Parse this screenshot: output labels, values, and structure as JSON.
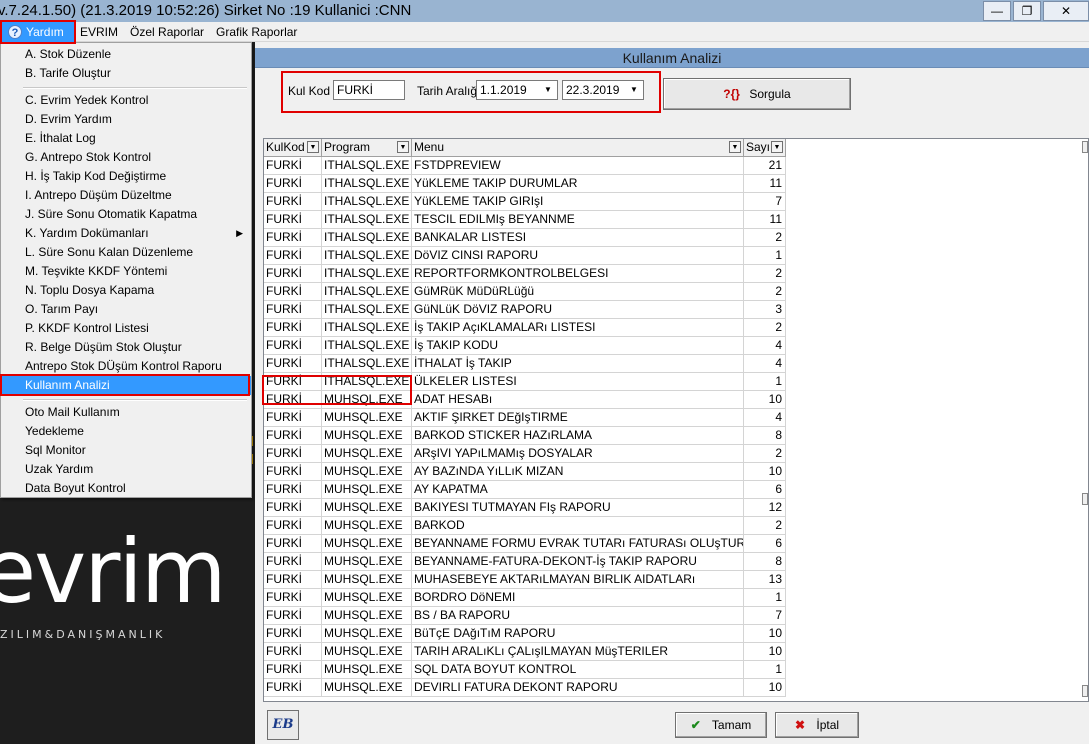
{
  "window": {
    "title": "v.7.24.1.50) (21.3.2019 10:52:26) Sirket No :19 Kullanici :CNN",
    "min_label": "—",
    "max_label": "❐",
    "close_label": "✕"
  },
  "menubar": {
    "items": [
      {
        "label": "Yardım"
      },
      {
        "label": "EVRIM"
      },
      {
        "label": "Özel Raporlar"
      },
      {
        "label": "Grafik Raporlar"
      }
    ]
  },
  "dropdown": {
    "items": [
      {
        "label": "A.  Stok Düzenle"
      },
      {
        "label": "B.  Tarife Oluştur"
      },
      {
        "label": "C.  Evrim Yedek Kontrol"
      },
      {
        "label": "D.  Evrim Yardım"
      },
      {
        "label": "E.  İthalat Log"
      },
      {
        "label": "G.  Antrepo Stok Kontrol"
      },
      {
        "label": "H.  İş Takip Kod Değiştirme"
      },
      {
        "label": "I.   Antrepo Düşüm Düzeltme"
      },
      {
        "label": "J.  Süre Sonu Otomatik Kapatma"
      },
      {
        "label": "K.  Yardım Dokümanları"
      },
      {
        "label": "L. Süre Sonu Kalan Düzenleme"
      },
      {
        "label": "M. Teşvikte KKDF Yöntemi"
      },
      {
        "label": "N. Toplu Dosya Kapama"
      },
      {
        "label": "O. Tarım Payı"
      },
      {
        "label": "P. KKDF Kontrol Listesi"
      },
      {
        "label": "R. Belge Düşüm Stok Oluştur"
      },
      {
        "label": "Antrepo Stok DÜşüm Kontrol Raporu"
      },
      {
        "label": "Kullanım Analizi"
      },
      {
        "label": "Oto Mail Kullanım"
      },
      {
        "label": "Yedekleme"
      },
      {
        "label": "Sql Monitor"
      },
      {
        "label": "Uzak Yardım"
      },
      {
        "label": "Data Boyut Kontrol"
      }
    ],
    "submenu_arrow": "▶"
  },
  "logo": {
    "word": "evrim",
    "sub": "ZILIM&DANIŞMANLIK"
  },
  "form": {
    "title": "Kullanım Analizi",
    "kulkod_label": "Kul Kod",
    "kulkod_value": "FURKİ",
    "tarih_label": "Tarih Aralığı",
    "date_from": "1.1.2019",
    "date_to": "22.3.2019",
    "sorgula_label": "Sorgula",
    "sorgula_icon": "?{}"
  },
  "grid": {
    "columns": [
      "KulKod",
      "Program",
      "Menu",
      "Sayı"
    ],
    "filter_glyph": "▼",
    "rows": [
      [
        "FURKİ",
        "ITHALSQL.EXE",
        "FSTDPREVIEW",
        "21"
      ],
      [
        "FURKİ",
        "ITHALSQL.EXE",
        "YüKLEME TAKIP DURUMLAR",
        "11"
      ],
      [
        "FURKİ",
        "ITHALSQL.EXE",
        "YüKLEME TAKIP GIRIşI",
        "7"
      ],
      [
        "FURKİ",
        "ITHALSQL.EXE",
        "TESCIL EDILMIş BEYANNME",
        "11"
      ],
      [
        "FURKİ",
        "ITHALSQL.EXE",
        "BANKALAR LISTESI",
        "2"
      ],
      [
        "FURKİ",
        "ITHALSQL.EXE",
        "DöVIZ CINSI RAPORU",
        "1"
      ],
      [
        "FURKİ",
        "ITHALSQL.EXE",
        "REPORTFORMKONTROLBELGESI",
        "2"
      ],
      [
        "FURKİ",
        "ITHALSQL.EXE",
        "GüMRüK MüDüRLüğü",
        "2"
      ],
      [
        "FURKİ",
        "ITHALSQL.EXE",
        "GüNLüK DöVIZ RAPORU",
        "3"
      ],
      [
        "FURKİ",
        "ITHALSQL.EXE",
        "İş TAKIP AçıKLAMALARı LISTESI",
        "2"
      ],
      [
        "FURKİ",
        "ITHALSQL.EXE",
        "İş TAKIP KODU",
        "4"
      ],
      [
        "FURKİ",
        "ITHALSQL.EXE",
        "İTHALAT İş TAKIP",
        "4"
      ],
      [
        "FURKİ",
        "ITHALSQL.EXE",
        "ÜLKELER LISTESI",
        "1"
      ],
      [
        "FURKİ",
        "MUHSQL.EXE",
        "ADAT HESABı",
        "10"
      ],
      [
        "FURKİ",
        "MUHSQL.EXE",
        "AKTIF ŞIRKET DEğIşTIRME",
        "4"
      ],
      [
        "FURKİ",
        "MUHSQL.EXE",
        "BARKOD STICKER HAZıRLAMA",
        "8"
      ],
      [
        "FURKİ",
        "MUHSQL.EXE",
        "ARşIVI YAPıLMAMış DOSYALAR",
        "2"
      ],
      [
        "FURKİ",
        "MUHSQL.EXE",
        "AY BAZıNDA YıLLıK MIZAN",
        "10"
      ],
      [
        "FURKİ",
        "MUHSQL.EXE",
        "AY KAPATMA",
        "6"
      ],
      [
        "FURKİ",
        "MUHSQL.EXE",
        "BAKIYESI TUTMAYAN FIş RAPORU",
        "12"
      ],
      [
        "FURKİ",
        "MUHSQL.EXE",
        "BARKOD",
        "2"
      ],
      [
        "FURKİ",
        "MUHSQL.EXE",
        "BEYANNAME FORMU EVRAK TUTARı FATURASı OLUşTURMA",
        "6"
      ],
      [
        "FURKİ",
        "MUHSQL.EXE",
        "BEYANNAME-FATURA-DEKONT-İş TAKIP RAPORU",
        "8"
      ],
      [
        "FURKİ",
        "MUHSQL.EXE",
        "MUHASEBEYE AKTARıLMAYAN BIRLIK AIDATLARı",
        "13"
      ],
      [
        "FURKİ",
        "MUHSQL.EXE",
        "BORDRO DöNEMI",
        "1"
      ],
      [
        "FURKİ",
        "MUHSQL.EXE",
        "BS / BA RAPORU",
        "7"
      ],
      [
        "FURKİ",
        "MUHSQL.EXE",
        "BüTçE DAğıTıM RAPORU",
        "10"
      ],
      [
        "FURKİ",
        "MUHSQL.EXE",
        "TARIH ARALıKLı ÇALışILMAYAN MüşTERILER",
        "10"
      ],
      [
        "FURKİ",
        "MUHSQL.EXE",
        "SQL DATA BOYUT KONTROL",
        "1"
      ],
      [
        "FURKİ",
        "MUHSQL.EXE",
        "DEVIRLI FATURA DEKONT RAPORU",
        "10"
      ]
    ]
  },
  "bottom": {
    "eb_label": "EB",
    "tamam_label": "Tamam",
    "iptal_label": "İptal"
  }
}
